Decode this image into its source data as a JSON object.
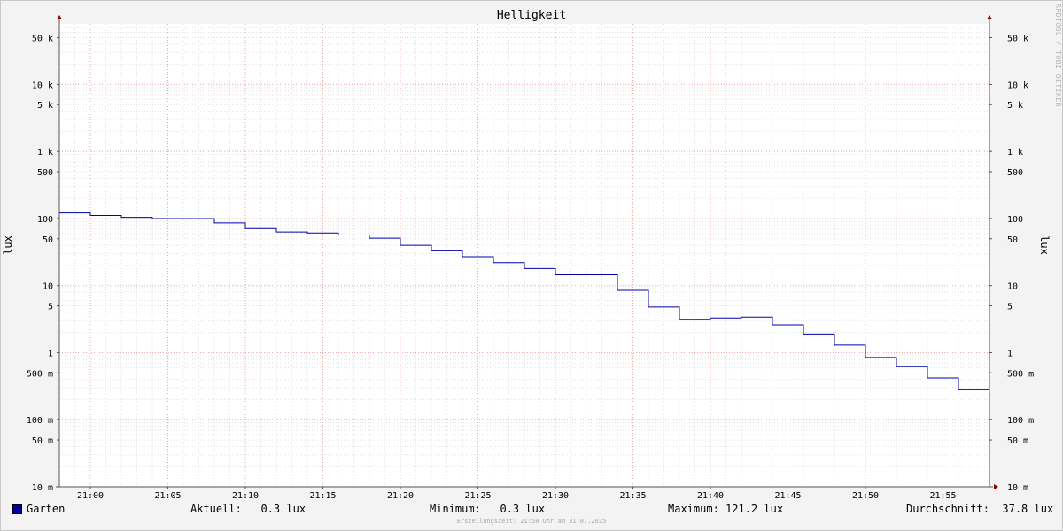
{
  "chart_data": {
    "type": "line",
    "title": "Helligkeit",
    "ylabel": "lux",
    "vendor_text": "RRDTOOL / TOBI OETIKER",
    "y_scale": "log",
    "ylim": [
      0.01,
      80000
    ],
    "x_range": [
      "20:58",
      "21:58"
    ],
    "y_ticks": [
      {
        "value": 50000,
        "label": "50 k"
      },
      {
        "value": 10000,
        "label": "10 k"
      },
      {
        "value": 5000,
        "label": "5 k"
      },
      {
        "value": 1000,
        "label": "1 k"
      },
      {
        "value": 500,
        "label": "500"
      },
      {
        "value": 100,
        "label": "100"
      },
      {
        "value": 50,
        "label": "50"
      },
      {
        "value": 10,
        "label": "10"
      },
      {
        "value": 5,
        "label": "5"
      },
      {
        "value": 1,
        "label": "1"
      },
      {
        "value": 0.5,
        "label": "500 m"
      },
      {
        "value": 0.1,
        "label": "100 m"
      },
      {
        "value": 0.05,
        "label": "50 m"
      },
      {
        "value": 0.01,
        "label": "10 m"
      }
    ],
    "x_ticks": [
      "21:00",
      "21:05",
      "21:10",
      "21:15",
      "21:20",
      "21:25",
      "21:30",
      "21:35",
      "21:40",
      "21:45",
      "21:50",
      "21:55"
    ],
    "series": [
      {
        "name": "Garten",
        "color": "#0000a8",
        "step": true,
        "x": [
          "20:58",
          "21:00",
          "21:02",
          "21:04",
          "21:06",
          "21:08",
          "21:10",
          "21:12",
          "21:14",
          "21:16",
          "21:18",
          "21:20",
          "21:22",
          "21:24",
          "21:26",
          "21:28",
          "21:30",
          "21:32",
          "21:34",
          "21:36",
          "21:38",
          "21:40",
          "21:42",
          "21:44",
          "21:46",
          "21:48",
          "21:50",
          "21:52",
          "21:54",
          "21:56"
        ],
        "values": [
          121.2,
          111,
          104,
          100,
          100,
          86,
          71,
          63,
          61,
          57,
          51,
          40,
          33,
          27,
          22,
          18,
          14.5,
          14.5,
          8.5,
          4.8,
          3.1,
          3.3,
          3.4,
          2.6,
          1.9,
          1.3,
          0.85,
          0.62,
          0.42,
          0.28
        ]
      }
    ],
    "grid": true
  },
  "legend": {
    "series_label": "Garten",
    "aktuell": "Aktuell:   0.3 lux",
    "minimum": "Minimum:   0.3 lux",
    "maximum": "Maximum: 121.2 lux",
    "durchschnitt": "Durchschnitt:  37.8 lux"
  },
  "footer": "Erstellungszeit: 21:58 Uhr am 31.07.2025"
}
